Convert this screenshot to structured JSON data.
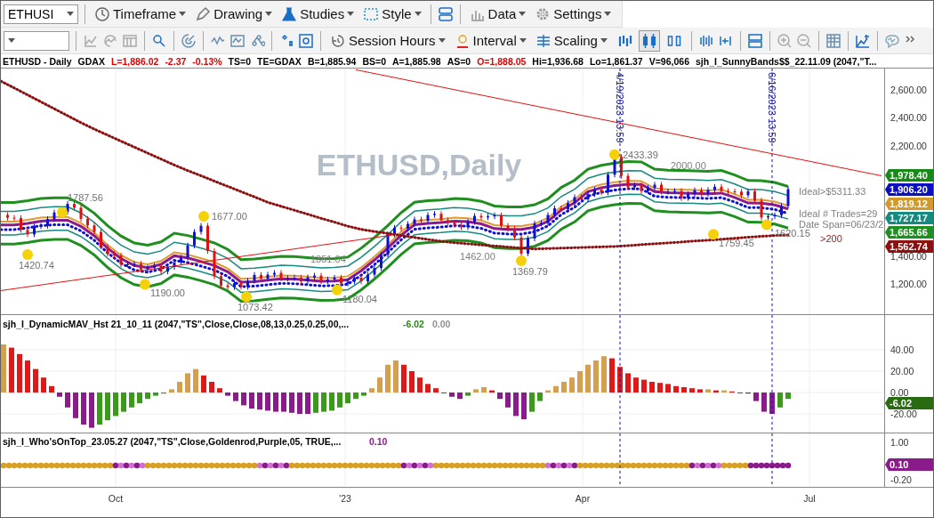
{
  "toolbar": {
    "symbol_field": {
      "value": "ETHUSI"
    },
    "menus": [
      {
        "label": "Timeframe"
      },
      {
        "label": "Drawing"
      },
      {
        "label": "Studies"
      },
      {
        "label": "Style"
      },
      {
        "label": "Data"
      },
      {
        "label": "Settings"
      }
    ]
  },
  "toolbar2": {
    "menus": [
      {
        "label": "Session Hours"
      },
      {
        "label": "Interval"
      },
      {
        "label": "Scaling"
      }
    ],
    "chart_type_buttons": [
      {
        "kind": "line",
        "selected": false
      },
      {
        "kind": "candle",
        "selected": true
      },
      {
        "kind": "hollow",
        "selected": false
      }
    ]
  },
  "info_line": [
    {
      "text": "ETHUSD - Daily",
      "color": "#000000"
    },
    {
      "text": "GDAX",
      "color": "#000000"
    },
    {
      "text": "L=1,886.02",
      "color": "#e00000"
    },
    {
      "text": "-2.37",
      "color": "#e00000"
    },
    {
      "text": "-0.13%",
      "color": "#e00000"
    },
    {
      "text": "TS=0",
      "color": "#000000"
    },
    {
      "text": "TE=GDAX",
      "color": "#000000"
    },
    {
      "text": "B=1,885.94",
      "color": "#000000"
    },
    {
      "text": "BS=0",
      "color": "#000000"
    },
    {
      "text": "A=1,885.98",
      "color": "#000000"
    },
    {
      "text": "AS=0",
      "color": "#000000"
    },
    {
      "text": "O=1,888.05",
      "color": "#e00000"
    },
    {
      "text": "Hi=1,936.68",
      "color": "#000000"
    },
    {
      "text": "Lo=1,861.37",
      "color": "#000000"
    },
    {
      "text": "V=96,066",
      "color": "#000000"
    },
    {
      "text": "sjh_I_SunnyBands$$_22.11.09 (2047,\"T...",
      "color": "#000000"
    }
  ],
  "price_pane": {
    "watermark": "ETHUSD,Daily",
    "time_markers": [
      {
        "label": "4/19/2023 13:59"
      },
      {
        "label": "6/16/2023 13:59"
      }
    ],
    "axis_labels": [
      "2,600.00",
      "2,400.00",
      "2,200.00",
      "1,400.00",
      "1,200.00"
    ],
    "price_labels": [
      {
        "kind": "swing",
        "text": "1787.56"
      },
      {
        "kind": "swing",
        "text": "1420.74"
      },
      {
        "kind": "swing",
        "text": "1677.00"
      },
      {
        "kind": "swing",
        "text": "1190.00"
      },
      {
        "kind": "swing",
        "text": "1073.42"
      },
      {
        "kind": "text",
        "text": "1351.04",
        "color": "#808080"
      },
      {
        "kind": "swing",
        "text": "1180.04"
      },
      {
        "kind": "text",
        "text": "1462.00",
        "color": "#808080"
      },
      {
        "kind": "swing",
        "text": "1369.79"
      },
      {
        "kind": "swing",
        "text": "2433.39"
      },
      {
        "kind": "text",
        "text": "2000.00",
        "color": "#808080"
      },
      {
        "kind": "swing",
        "text": "1759.45"
      },
      {
        "kind": "swing",
        "text": "1620.15"
      },
      {
        "kind": "text",
        "text": "Ideal>$5311.33",
        "color": "#808080"
      },
      {
        "kind": "text",
        "text": "Ideal # Trades=29",
        "color": "#808080"
      },
      {
        "kind": "text",
        "text": "Date Span=06/23/2",
        "color": "#808080"
      },
      {
        "kind": "text",
        "text": ">200",
        "color": "#a02020"
      }
    ],
    "badges": [
      {
        "label": "1,978.40",
        "color": "#168a16"
      },
      {
        "label": "1,906.20",
        "color": "#0a10c0"
      },
      {
        "label": "1,819.12",
        "color": "#d29a2a"
      },
      {
        "label": "1,727.17",
        "color": "#178a80"
      },
      {
        "label": "1,665.66",
        "color": "#1f8f1f"
      },
      {
        "label": "1,562.74",
        "color": "#8b1010"
      }
    ]
  },
  "histogram_pane": {
    "title": "sjh_I_DynamicMAV_Hst 21_10_11 (2047,\"TS\",Close,Close,08,13,0.25,0.25,00,...",
    "readings": [
      {
        "text": "-6.02",
        "color": "#2a8a10"
      },
      {
        "text": "0.00",
        "color": "#909090"
      }
    ],
    "axis_labels": [
      "40.00",
      "20.00",
      "0.00",
      "-20.00"
    ],
    "badge": {
      "label": "-6.02",
      "color": "#2a6a10"
    }
  },
  "dots_pane": {
    "title": "sjh_I_Who'sOnTop_23.05.27 (2047,\"TS\",Close,Goldenrod,Purple,05,  TRUE,...",
    "reading": {
      "text": "0.10",
      "color": "#8b1a8b"
    },
    "axis_labels": [
      "1.00",
      "-0.20"
    ],
    "badge": {
      "label": "0.10",
      "color": "#8b1a8b"
    }
  },
  "x_axis": {
    "labels": [
      "Oct",
      "'23",
      "Apr",
      "Jul"
    ]
  }
}
